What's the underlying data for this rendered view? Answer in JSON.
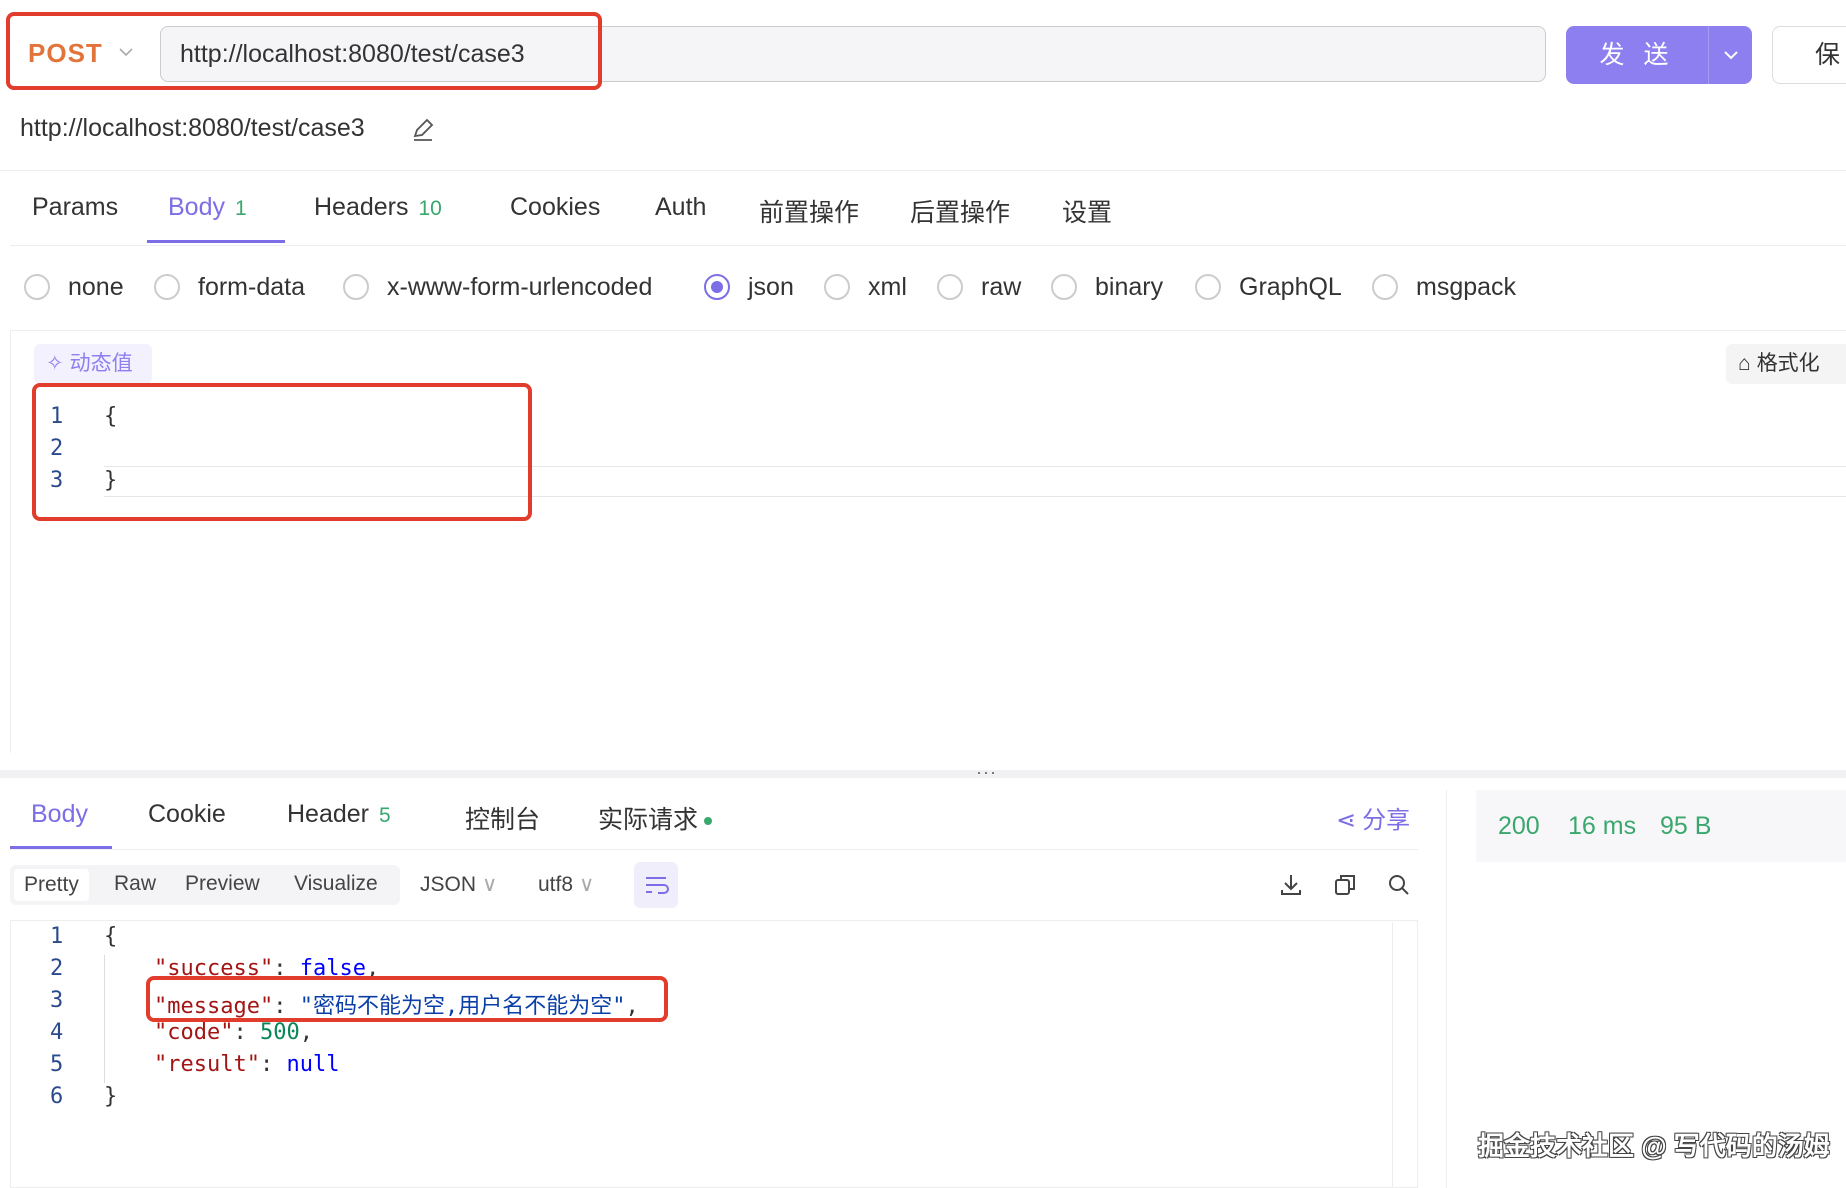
{
  "request": {
    "method": "POST",
    "url": "http://localhost:8080/test/case3",
    "send_label": "发 送",
    "save_label": "保",
    "name": "http://localhost:8080/test/case3"
  },
  "tabs": [
    {
      "label": "Params",
      "count": ""
    },
    {
      "label": "Body",
      "count": "1"
    },
    {
      "label": "Headers",
      "count": "10"
    },
    {
      "label": "Cookies",
      "count": ""
    },
    {
      "label": "Auth",
      "count": ""
    },
    {
      "label": "前置操作",
      "count": ""
    },
    {
      "label": "后置操作",
      "count": ""
    },
    {
      "label": "设置",
      "count": ""
    }
  ],
  "active_tab": "Body",
  "body_types": [
    "none",
    "form-data",
    "x-www-form-urlencoded",
    "json",
    "xml",
    "raw",
    "binary",
    "GraphQL",
    "msgpack"
  ],
  "selected_body_type": "json",
  "editor": {
    "dynamic_label": "动态值",
    "format_label": "格式化",
    "lines": [
      "{",
      "",
      "}"
    ]
  },
  "response": {
    "tabs": [
      {
        "label": "Body",
        "count": ""
      },
      {
        "label": "Cookie",
        "count": ""
      },
      {
        "label": "Header",
        "count": "5"
      },
      {
        "label": "控制台",
        "count": ""
      },
      {
        "label": "实际请求",
        "count": ""
      }
    ],
    "share_label": "分享",
    "views": [
      "Pretty",
      "Raw",
      "Preview",
      "Visualize"
    ],
    "format": "JSON",
    "encoding": "utf8",
    "status": "200",
    "time": "16 ms",
    "size": "95 B",
    "json": {
      "l1": "{",
      "success_key": "\"success\"",
      "success_val": "false",
      "message_key": "\"message\"",
      "message_val": "\"密码不能为空,用户名不能为空\"",
      "code_key": "\"code\"",
      "code_val": "500",
      "result_key": "\"result\"",
      "result_val": "null",
      "l6": "}"
    }
  },
  "watermark": "掘金技术社区 @ 写代码的汤姆",
  "colors": {
    "accent": "#7b6ee6",
    "method": "#e2733a",
    "success": "#3aa76d",
    "highlight": "#e23c2c"
  }
}
